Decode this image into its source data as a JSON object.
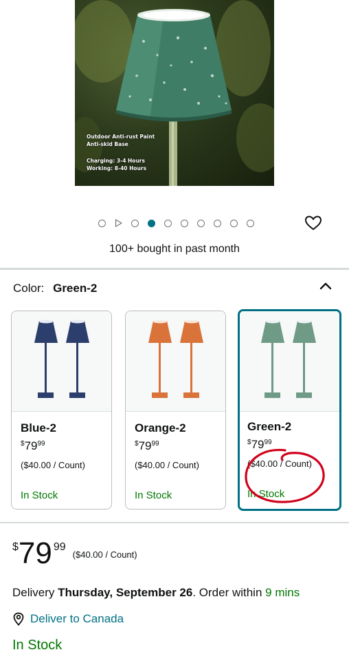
{
  "hero": {
    "feature_lines_1": [
      "Outdoor Anti-rust Paint",
      "Anti-skid Base"
    ],
    "feature_lines_2": [
      "Charging: 3-4 Hours",
      "Working: 8-40 Hours"
    ]
  },
  "carousel": {
    "dot_count": 9,
    "active_index": 2,
    "video_icon": "play-icon"
  },
  "social_proof": "100+ bought in past month",
  "color": {
    "label": "Color:",
    "selected": "Green-2"
  },
  "swatches": [
    {
      "name": "Blue-2",
      "currency": "$",
      "whole": "79",
      "fraction": "99",
      "unit_price": "($40.00 / Count)",
      "stock": "In Stock",
      "color": "#2c3e6b",
      "selected": false
    },
    {
      "name": "Orange-2",
      "currency": "$",
      "whole": "79",
      "fraction": "99",
      "unit_price": "($40.00 / Count)",
      "stock": "In Stock",
      "color": "#d9733a",
      "selected": false
    },
    {
      "name": "Green-2",
      "currency": "$",
      "whole": "79",
      "fraction": "99",
      "unit_price": "($40.00 / Count)",
      "stock": "In Stock",
      "color": "#6f9a86",
      "selected": true
    }
  ],
  "price": {
    "currency": "$",
    "whole": "79",
    "fraction": "99",
    "unit_price": "($40.00 / Count)"
  },
  "delivery": {
    "prefix": "Delivery ",
    "date": "Thursday, September 26",
    "middle": ". Order within ",
    "countdown": "9 mins"
  },
  "deliver_to": "Deliver to Canada",
  "availability": "In Stock",
  "colors": {
    "link": "#007185",
    "in_stock": "#007600",
    "selected_border": "#007185",
    "annotation": "#d0021b"
  }
}
